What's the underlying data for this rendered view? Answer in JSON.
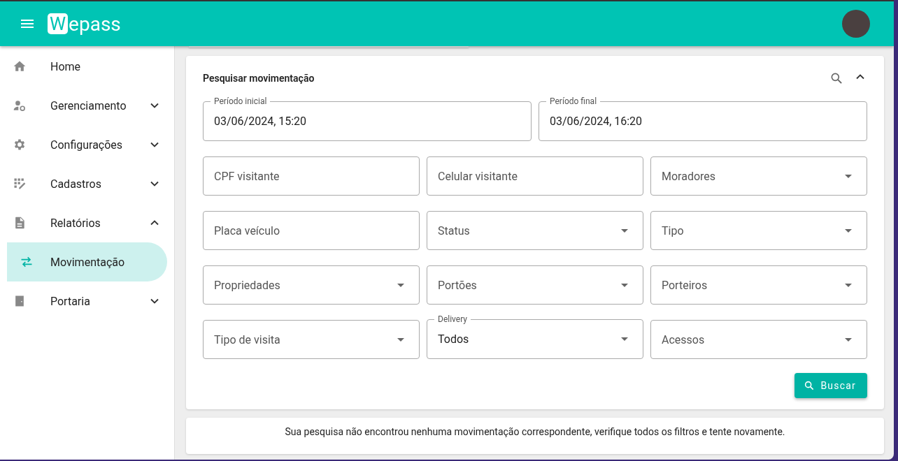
{
  "header": {
    "logo_letter": "W",
    "logo_text": "epass"
  },
  "sidebar": {
    "items": [
      {
        "label": "Home",
        "kind": "link",
        "selected": false
      },
      {
        "label": "Gerenciamento",
        "kind": "group",
        "expanded": false,
        "selected": false
      },
      {
        "label": "Configurações",
        "kind": "group",
        "expanded": false,
        "selected": false
      },
      {
        "label": "Cadastros",
        "kind": "group",
        "expanded": false,
        "selected": false
      },
      {
        "label": "Relatórios",
        "kind": "group",
        "expanded": true,
        "selected": false,
        "children": [
          {
            "label": "Movimentação",
            "selected": true
          }
        ]
      },
      {
        "label": "Portaria",
        "kind": "group",
        "expanded": false,
        "selected": false
      }
    ]
  },
  "search_panel": {
    "title": "Pesquisar movimentação",
    "expanded": true,
    "rows": [
      [
        {
          "kind": "date",
          "label": "Período inicial",
          "value": "03/06/2024, 15:20"
        },
        {
          "kind": "date",
          "label": "Período final",
          "value": "03/06/2024, 16:20"
        }
      ],
      [
        {
          "kind": "text",
          "placeholder": "CPF visitante"
        },
        {
          "kind": "text",
          "placeholder": "Celular visitante"
        },
        {
          "kind": "select",
          "placeholder": "Moradores"
        }
      ],
      [
        {
          "kind": "text",
          "placeholder": "Placa veículo"
        },
        {
          "kind": "select",
          "placeholder": "Status"
        },
        {
          "kind": "select",
          "placeholder": "Tipo"
        }
      ],
      [
        {
          "kind": "select",
          "placeholder": "Propriedades"
        },
        {
          "kind": "select",
          "placeholder": "Portões"
        },
        {
          "kind": "select",
          "placeholder": "Porteiros"
        }
      ],
      [
        {
          "kind": "select",
          "placeholder": "Tipo de visita"
        },
        {
          "kind": "select",
          "label": "Delivery",
          "value": "Todos"
        },
        {
          "kind": "select",
          "placeholder": "Acessos"
        }
      ]
    ],
    "button": "Buscar"
  },
  "result_message": "Sua pesquisa não encontrou nenhuma movimentação correspondente, verifique todos os filtros e tente novamente."
}
